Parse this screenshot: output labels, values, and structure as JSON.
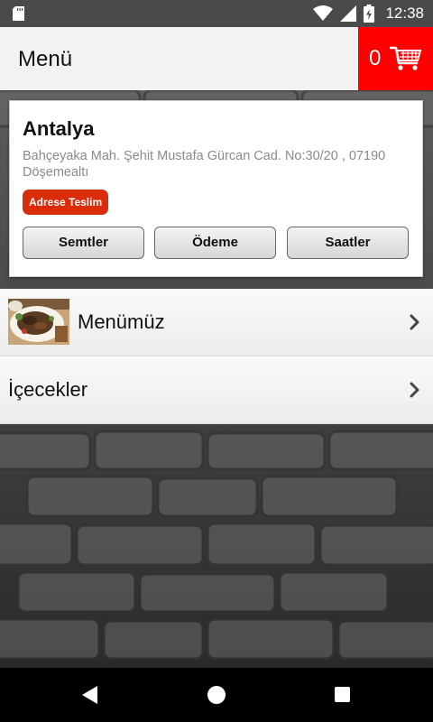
{
  "status_bar": {
    "time": "12:38",
    "icons": [
      "sd-card-icon",
      "wifi-icon",
      "cell-signal-icon",
      "battery-charging-icon"
    ]
  },
  "app_bar": {
    "title": "Menü",
    "cart_count": "0",
    "cart_color": "#ff0000"
  },
  "branch": {
    "city": "Antalya",
    "address": "Bahçeyaka Mah. Şehit Mustafa Gürcan Cad. No:30/20 , 07190 Döşemealtı",
    "delivery_badge": "Adrese Teslim",
    "badge_color": "#d92c0b",
    "buttons": {
      "districts": "Semtler",
      "payment": "Ödeme",
      "hours": "Saatler"
    }
  },
  "categories": [
    {
      "label": "Menümüz",
      "has_image": true,
      "icon": "chevron-right-icon"
    },
    {
      "label": "İçecekler",
      "has_image": false,
      "icon": "chevron-right-icon"
    }
  ],
  "nav_bar": {
    "icons": [
      "back-icon",
      "home-icon",
      "recents-icon"
    ]
  }
}
